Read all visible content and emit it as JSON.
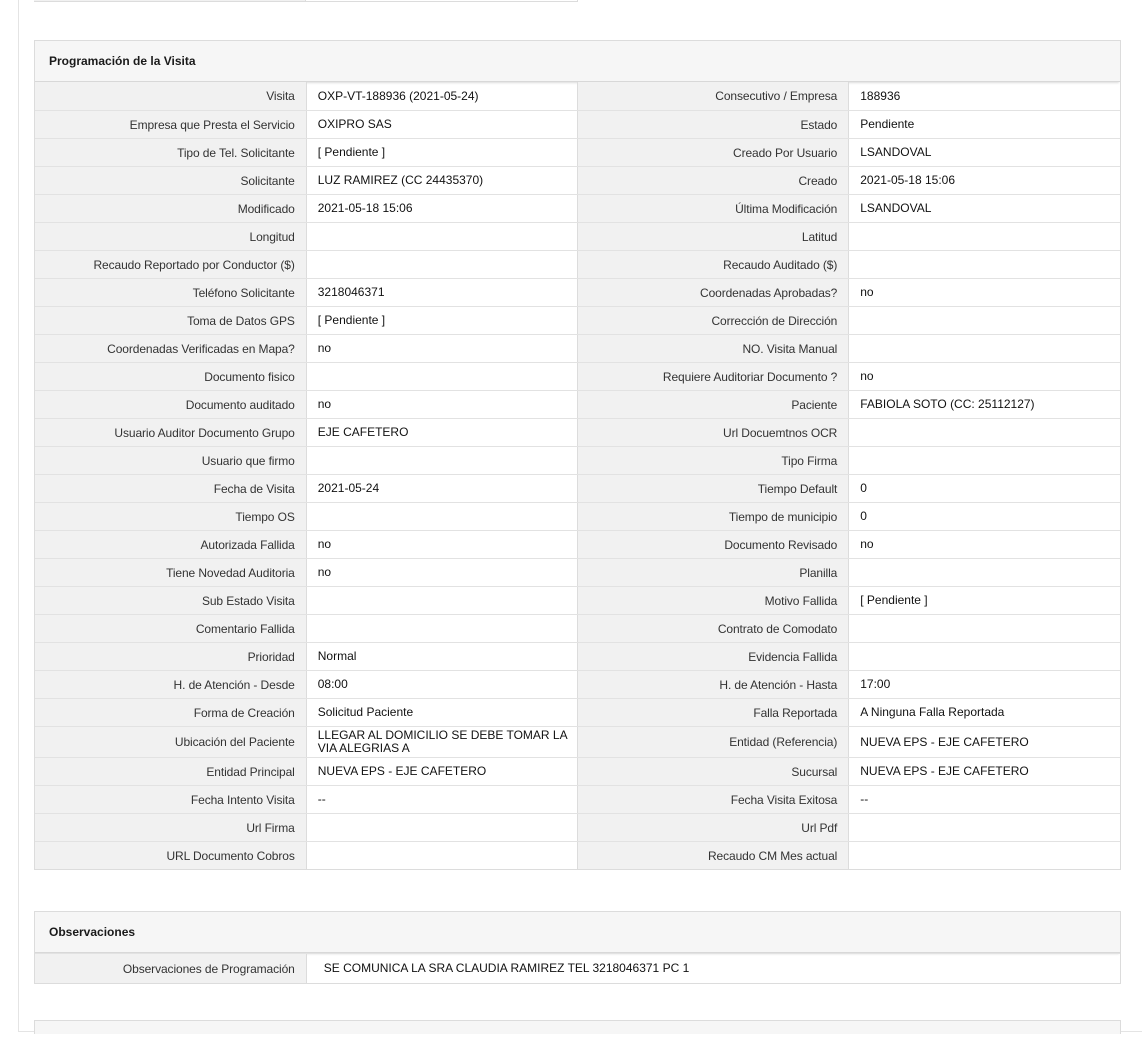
{
  "sections": {
    "programacion": {
      "title": "Programación de la Visita",
      "rows": [
        [
          "Visita",
          "OXP-VT-188936 (2021-05-24)",
          "Consecutivo / Empresa",
          "188936"
        ],
        [
          "Empresa que Presta el Servicio",
          "OXIPRO SAS",
          "Estado",
          "Pendiente"
        ],
        [
          "Tipo de Tel. Solicitante",
          "[ Pendiente ]",
          "Creado Por Usuario",
          "LSANDOVAL"
        ],
        [
          "Solicitante",
          "LUZ RAMIREZ (CC 24435370)",
          "Creado",
          "2021-05-18 15:06"
        ],
        [
          "Modificado",
          "2021-05-18 15:06",
          "Última Modificación",
          " LSANDOVAL"
        ],
        [
          "Longitud",
          "",
          "Latitud",
          ""
        ],
        [
          "Recaudo Reportado por Conductor ($)",
          "",
          "Recaudo Auditado ($)",
          ""
        ],
        [
          "Teléfono Solicitante",
          "3218046371",
          "Coordenadas Aprobadas?",
          " no"
        ],
        [
          "Toma de Datos GPS",
          "[ Pendiente ]",
          "Corrección de Dirección",
          ""
        ],
        [
          "Coordenadas Verificadas en Mapa?",
          " no",
          "NO. Visita Manual",
          ""
        ],
        [
          "Documento fisico",
          "",
          "Requiere Auditoriar Documento ?",
          " no"
        ],
        [
          "Documento auditado",
          " no",
          "Paciente",
          "FABIOLA SOTO (CC: 25112127)"
        ],
        [
          "Usuario Auditor Documento Grupo",
          "EJE CAFETERO",
          "Url Docuemtnos OCR",
          ""
        ],
        [
          "Usuario que firmo",
          "",
          "Tipo Firma",
          ""
        ],
        [
          "Fecha de Visita",
          " 2021-05-24",
          "Tiempo Default",
          "0"
        ],
        [
          "Tiempo OS",
          "",
          "Tiempo de municipio",
          "0"
        ],
        [
          "Autorizada Fallida",
          " no",
          "Documento Revisado",
          " no"
        ],
        [
          "Tiene Novedad Auditoria",
          " no",
          "Planilla",
          ""
        ],
        [
          "Sub Estado Visita",
          "",
          "Motivo Fallida",
          "[ Pendiente ]"
        ],
        [
          "Comentario Fallida",
          "",
          "Contrato de Comodato",
          ""
        ],
        [
          "Prioridad",
          "Normal",
          "Evidencia Fallida",
          ""
        ],
        [
          "H. de Atención - Desde",
          "08:00",
          "H. de Atención - Hasta",
          "17:00"
        ],
        [
          "Forma de Creación",
          "Solicitud Paciente",
          "Falla Reportada",
          "A Ninguna Falla Reportada"
        ],
        [
          "Ubicación del Paciente",
          "LLEGAR AL DOMICILIO SE DEBE TOMAR LA VIA ALEGRIAS A",
          "Entidad (Referencia)",
          "NUEVA EPS - EJE CAFETERO"
        ],
        [
          "Entidad Principal",
          "NUEVA EPS - EJE CAFETERO",
          "Sucursal",
          "NUEVA EPS - EJE CAFETERO"
        ],
        [
          "Fecha Intento Visita",
          " --",
          "Fecha Visita Exitosa",
          " --"
        ],
        [
          "Url Firma",
          "",
          "Url Pdf",
          ""
        ],
        [
          "URL Documento Cobros",
          "",
          "Recaudo CM Mes actual",
          ""
        ]
      ]
    },
    "observaciones": {
      "title": "Observaciones",
      "label": "Observaciones de Programación",
      "value": "SE COMUNICA LA SRA CLAUDIA RAMIREZ TEL 3218046371 PC 1"
    }
  }
}
